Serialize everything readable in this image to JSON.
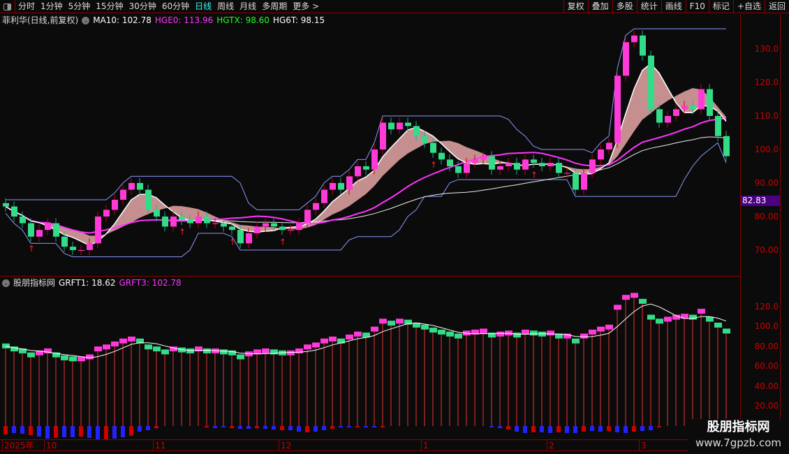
{
  "topbar": {
    "periods": [
      "分时",
      "1分钟",
      "5分钟",
      "15分钟",
      "30分钟",
      "60分钟",
      "日线",
      "周线",
      "月线",
      "多周期",
      "更多 >"
    ],
    "active": "日线",
    "right_buttons": [
      "复权",
      "叠加",
      "多股",
      "统计",
      "画线",
      "F10",
      "标记",
      "+自选",
      "返回"
    ]
  },
  "main_legend": {
    "title": "菲利华(日线,前复权)",
    "ma10": "MA10: 102.78",
    "hge0": "HGE0: 113.96",
    "hgtx": "HGTX: 98.60",
    "hg6t": "HG6T: 98.15"
  },
  "sub_legend": {
    "title": "股朋指标网",
    "grft1": "GRFT1: 18.62",
    "grft3": "GRFT3: 102.78"
  },
  "price_badge": "82.83",
  "main_axis": [
    "130.0",
    "120.0",
    "110.0",
    "100.0",
    "90.00",
    "80.00",
    "70.00"
  ],
  "sub_axis": [
    "120.0",
    "100.0",
    "80.00",
    "60.00",
    "40.00",
    "20.00"
  ],
  "dates": [
    {
      "label": "2025年",
      "i": 0
    },
    {
      "label": "10",
      "i": 5
    },
    {
      "label": "11",
      "i": 18
    },
    {
      "label": "12",
      "i": 33
    },
    {
      "label": "1",
      "i": 50
    },
    {
      "label": "2",
      "i": 65
    },
    {
      "label": "3",
      "i": 76
    }
  ],
  "watermark": {
    "name": "股朋指标网",
    "url": "www.7gpzb.com"
  },
  "colors": {
    "up": "#ff3ad9",
    "down": "#33dd88",
    "ma": "#ff33ff",
    "band": "#8899ff",
    "white": "#ffffff"
  },
  "chart_data": {
    "type": "candlestick",
    "ylim": [
      65,
      137
    ],
    "closes": [
      83,
      80,
      78,
      74,
      76,
      78,
      74,
      71,
      70,
      70,
      72,
      80,
      82,
      85,
      88,
      90,
      88,
      82,
      80,
      77,
      80,
      79,
      78,
      80,
      78,
      78,
      77,
      76,
      72,
      75,
      77,
      78,
      77,
      76,
      76,
      78,
      82,
      84,
      88,
      90,
      88,
      92,
      95,
      94,
      100,
      108,
      106,
      108,
      107,
      104,
      102,
      99,
      97,
      95,
      93,
      96,
      97,
      98,
      94,
      95,
      96,
      94,
      97,
      96,
      95,
      96,
      93,
      93,
      88,
      93,
      97,
      100,
      102,
      122,
      132,
      134,
      128,
      112,
      108,
      110,
      112,
      113,
      112,
      118,
      110,
      104,
      98
    ],
    "hist": [
      -12,
      -10,
      -11,
      -13,
      -15,
      -18,
      -17,
      -16,
      -16,
      -15,
      -17,
      -19,
      -20,
      -18,
      -16,
      -14,
      -8,
      -6,
      -3,
      0,
      0,
      0,
      0,
      0,
      -2,
      -3,
      -2,
      -3,
      -4,
      -4,
      -3,
      -4,
      -5,
      -6,
      -6,
      -8,
      -9,
      -8,
      -6,
      -4,
      -2,
      -2,
      -2,
      -2,
      -2,
      -2,
      0,
      0,
      0,
      0,
      0,
      0,
      0,
      0,
      0,
      0,
      0,
      0,
      -2,
      -3,
      -5,
      -8,
      -10,
      -9,
      -9,
      -10,
      -9,
      -10,
      -10,
      -8,
      -7,
      -8,
      -7,
      -9,
      -10,
      -8,
      -7,
      -6,
      -2,
      0,
      0,
      0,
      0,
      0,
      0,
      0,
      0
    ],
    "sub_ylim": [
      10,
      130
    ]
  }
}
